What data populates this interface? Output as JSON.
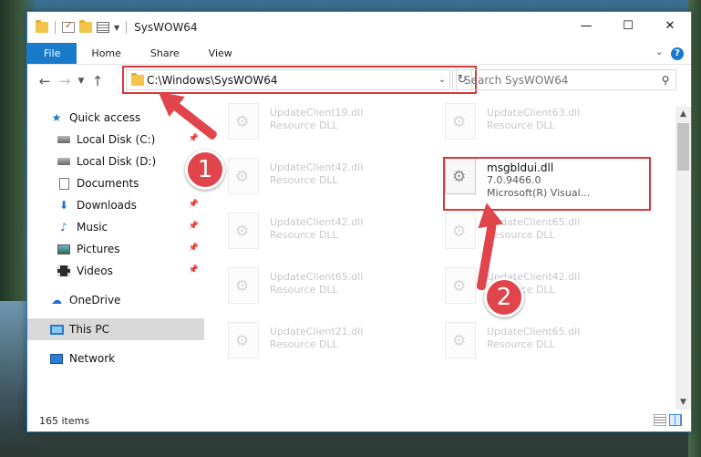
{
  "window": {
    "title": "SysWOW64",
    "controls": {
      "minimize": "—",
      "maximize": "☐",
      "close": "✕"
    }
  },
  "ribbon": {
    "tabs": [
      {
        "label": "File"
      },
      {
        "label": "Home"
      },
      {
        "label": "Share"
      },
      {
        "label": "View"
      }
    ],
    "help": "?"
  },
  "navigation": {
    "address": "C:\\Windows\\SysWOW64",
    "search_placeholder": "Search SysWOW64"
  },
  "sidebar": {
    "items": [
      {
        "label": "Quick access",
        "icon": "star-icon"
      },
      {
        "label": "Local Disk (C:)",
        "icon": "drive-icon"
      },
      {
        "label": "Local Disk (D:)",
        "icon": "drive-icon"
      },
      {
        "label": "Documents",
        "icon": "documents-icon"
      },
      {
        "label": "Downloads",
        "icon": "downloads-icon"
      },
      {
        "label": "Music",
        "icon": "music-icon"
      },
      {
        "label": "Pictures",
        "icon": "pictures-icon"
      },
      {
        "label": "Videos",
        "icon": "videos-icon"
      },
      {
        "label": "OneDrive",
        "icon": "cloud-icon"
      },
      {
        "label": "This PC",
        "icon": "computer-icon"
      },
      {
        "label": "Network",
        "icon": "network-icon"
      }
    ]
  },
  "files": [
    {
      "name": "UpdateClient19.dll",
      "sub": "Resource DLL"
    },
    {
      "name": "UpdateClient63.dll",
      "sub": "Resource DLL"
    },
    {
      "name": "UpdateClient42.dll",
      "sub": "Resource DLL"
    },
    {
      "name": "msgbldui.dll",
      "version": "7.0.9466.0",
      "company": "Microsoft(R) Visual..."
    },
    {
      "name": "UpdateClient42.dll",
      "sub": "Resource DLL"
    },
    {
      "name": "UpdateClient65.dll",
      "sub": "Resource DLL"
    },
    {
      "name": "UpdateClient65.dll",
      "sub": "Resource DLL"
    },
    {
      "name": "UpdateClient42.dll",
      "sub": "Resource DLL"
    },
    {
      "name": "UpdateClient21.dll",
      "sub": "Resource DLL"
    },
    {
      "name": "UpdateClient65.dll",
      "sub": "Resource DLL"
    }
  ],
  "status": {
    "count": "165 items"
  },
  "annotations": {
    "step1": "1",
    "step2": "2",
    "color": "#e0454b"
  }
}
